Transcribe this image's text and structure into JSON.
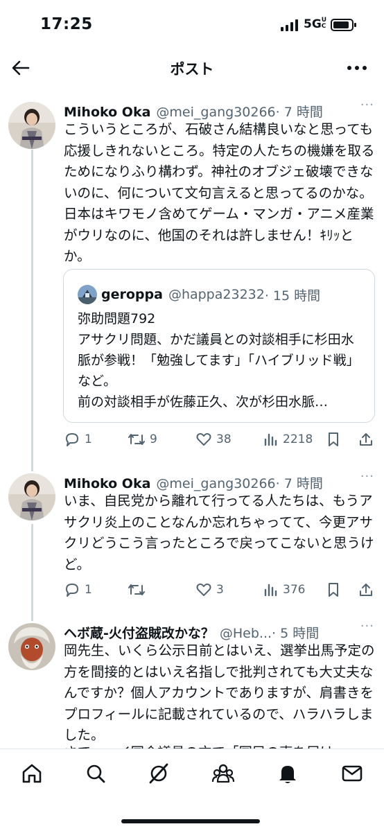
{
  "status": {
    "time": "17:25",
    "network": "5G",
    "network_sup": "UC"
  },
  "header": {
    "title": "ポスト",
    "back_icon": "arrow-left-icon",
    "more_icon": "ellipsis-icon"
  },
  "tweets": [
    {
      "author": "Mihoko Oka",
      "handle": "@mei_gang30266",
      "time": "· 7 時間",
      "more": "···",
      "body": "こういうところが、石破さん結構良いなと思っても応援しきれないところ。特定の人たちの機嫌を取るためになりふり構わず。神社のオブジェ破壊できないのに、何について文句言えると思ってるのかな。日本はキワモノ含めてゲーム・マンガ・アニメ産業がウリなのに、他国のそれは許しません！ｷﾘｯとか。",
      "quote": {
        "author": "geroppa",
        "handle": "@happa23232",
        "time": "· 15 時間",
        "body": "弥助問題792\nアサクリ問題、かだ議員との対談相手に杉田水脈が参戦！「勉強してます」「ハイブリッド戦」など。\n前の対談相手が佐藤正久、次が杉田水脈…"
      },
      "stats": {
        "replies": "1",
        "retweets": "9",
        "likes": "38",
        "views": "2218"
      }
    },
    {
      "author": "Mihoko Oka",
      "handle": "@mei_gang30266",
      "time": "· 7 時間",
      "more": "···",
      "body": "いま、自民党から離れて行ってる人たちは、もうアサクリ炎上のことなんか忘れちゃってて、今更アサクリどうこう言ったところで戻ってこないと思うけど。",
      "stats": {
        "replies": "1",
        "retweets": "",
        "likes": "3",
        "views": "376"
      }
    },
    {
      "author": "ヘボ蔵-火付盗賊改かな？",
      "handle": "@Heb...",
      "time": "· 5 時間",
      "more": "···",
      "body": "岡先生、いくら公示日前とはいえ、選挙出馬予定の方を間接的とはいえ名指しで批判されても大丈夫なんですか？個人アカウントでありますが、肩書きをプロフィールに記載されているので、ハラハラしました。",
      "body_cut": "さて、ーイ国会議員の方で「国民の声を届け"
    }
  ],
  "tabbar": {
    "items": [
      "home-icon",
      "search-icon",
      "grok-icon",
      "communities-icon",
      "notifications-icon",
      "messages-icon"
    ]
  }
}
